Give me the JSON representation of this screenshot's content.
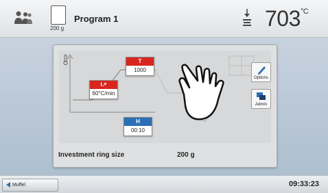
{
  "header": {
    "ring_size_label": "200 g",
    "program_name": "Program 1",
    "temperature": "703",
    "temperature_unit": "°C"
  },
  "program_graph": {
    "holding_top_label": "T",
    "holding_top_value": "1000",
    "heat_rate_label": "t↗",
    "heat_rate_value": "60°C/min",
    "holding_time_label": "H",
    "holding_time_value": "00:10"
  },
  "side_buttons": {
    "options_label": "Options",
    "admin_label": "Admin"
  },
  "investment_ring": {
    "label": "Investment ring size",
    "value": "200 g"
  },
  "statusbar": {
    "muffle_label": "Muffel",
    "time": "09:33:23"
  },
  "colors": {
    "accent_red": "#d9251d",
    "accent_blue": "#2b6fb6",
    "background_blue": "#b8c6d6"
  },
  "icons": [
    "users-icon",
    "ring-icon",
    "lower-lift-icon",
    "thermometer-icon",
    "pencil-icon",
    "admin-icon",
    "hand-pointer-icon",
    "back-arrow-icon"
  ]
}
